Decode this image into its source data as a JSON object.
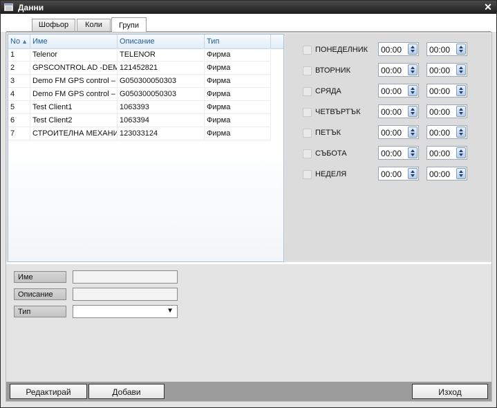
{
  "window": {
    "title": "Данни"
  },
  "tabs": [
    {
      "label": "Шофьор"
    },
    {
      "label": "Коли"
    },
    {
      "label": "Групи"
    }
  ],
  "grid": {
    "columns": [
      "No",
      "Име",
      "Описание",
      "Тип"
    ],
    "rows": [
      {
        "no": "1",
        "name": "Telenor",
        "description": "TELENOR",
        "type": "Фирма"
      },
      {
        "no": "2",
        "name": "GPSCONTROL AD -DEM",
        "description": "121452821",
        "type": "Фирма"
      },
      {
        "no": "3",
        "name": "Demo FM GPS control –",
        "description": "G050300050303",
        "type": "Фирма"
      },
      {
        "no": "4",
        "name": "Demo FM GPS control –",
        "description": "G050300050303",
        "type": "Фирма"
      },
      {
        "no": "5",
        "name": "Test Client1",
        "description": "1063393",
        "type": "Фирма"
      },
      {
        "no": "6",
        "name": "Test Client2",
        "description": "1063394",
        "type": "Фирма"
      },
      {
        "no": "7",
        "name": "СТРОИТЕЛНА МЕХАНИ",
        "description": "123033124",
        "type": "Фирма"
      }
    ]
  },
  "schedule": [
    {
      "day": "ПОНЕДЕЛНИК",
      "from": "00:00",
      "to": "00:00"
    },
    {
      "day": "ВТОРНИК",
      "from": "00:00",
      "to": "00:00"
    },
    {
      "day": "СРЯДА",
      "from": "00:00",
      "to": "00:00"
    },
    {
      "day": "ЧЕТВЪРТЪК",
      "from": "00:00",
      "to": "00:00"
    },
    {
      "day": "ПЕТЪК",
      "from": "00:00",
      "to": "00:00"
    },
    {
      "day": "СЪБОТА",
      "from": "00:00",
      "to": "00:00"
    },
    {
      "day": "НЕДЕЛЯ",
      "from": "00:00",
      "to": "00:00"
    }
  ],
  "form": {
    "name_label": "Име",
    "name_value": "",
    "description_label": "Описание",
    "description_value": "",
    "type_label": "Тип",
    "type_value": ""
  },
  "footer": {
    "edit_label": "Редактирай",
    "add_label": "Добави",
    "exit_label": "Изход"
  },
  "icons": {
    "window": "window-icon",
    "close": "close-icon",
    "sort": "sort-asc-icon",
    "spin": "spin-up-down-icon",
    "dropdown": "dropdown-arrow-icon"
  }
}
